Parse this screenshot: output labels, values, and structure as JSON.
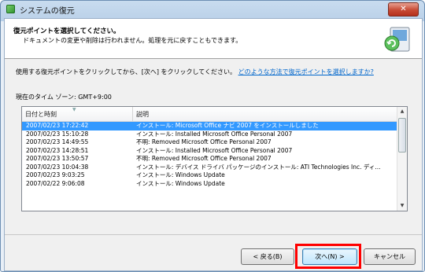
{
  "window": {
    "title": "システムの復元",
    "close_label": "✕"
  },
  "header": {
    "title": "復元ポイントを選択してください。",
    "subtitle": "ドキュメントの変更や削除は行われません。処理を元に戻すこともできます。"
  },
  "instruction": {
    "text": "使用する復元ポイントをクリックしてから、[次へ] をクリックしてください。",
    "link": "どのような方法で復元ポイントを選択しますか?"
  },
  "timezone": "現在のタイム ゾーン: GMT+9:00",
  "list": {
    "columns": [
      "日付と時刻",
      "説明"
    ],
    "rows": [
      {
        "date": "2007/02/23 17:22:42",
        "desc": "インストール: Microsoft Office ナビ 2007 をインストールしました",
        "selected": true
      },
      {
        "date": "2007/02/23 15:10:28",
        "desc": "インストール: Installed Microsoft Office Personal 2007",
        "selected": false
      },
      {
        "date": "2007/02/23 14:49:55",
        "desc": "不明: Removed Microsoft Office Personal 2007",
        "selected": false
      },
      {
        "date": "2007/02/23 14:28:51",
        "desc": "インストール: Installed Microsoft Office Personal 2007",
        "selected": false
      },
      {
        "date": "2007/02/23 13:50:57",
        "desc": "不明: Removed Microsoft Office Personal 2007",
        "selected": false
      },
      {
        "date": "2007/02/23 10:04:38",
        "desc": "インストール: デバイス ドライバ パッケージのインストール: ATI Technologies Inc. ディ...",
        "selected": false
      },
      {
        "date": "2007/02/23 9:03:25",
        "desc": "インストール: Windows Update",
        "selected": false
      },
      {
        "date": "2007/02/22 9:06:08",
        "desc": "インストール: Windows Update",
        "selected": false
      }
    ]
  },
  "buttons": {
    "back": "< 戻る(B)",
    "next": "次へ(N) >",
    "cancel": "キャンセル"
  },
  "colors": {
    "selection": "#3399ff",
    "link": "#0066cc",
    "highlight": "#ff0000"
  }
}
